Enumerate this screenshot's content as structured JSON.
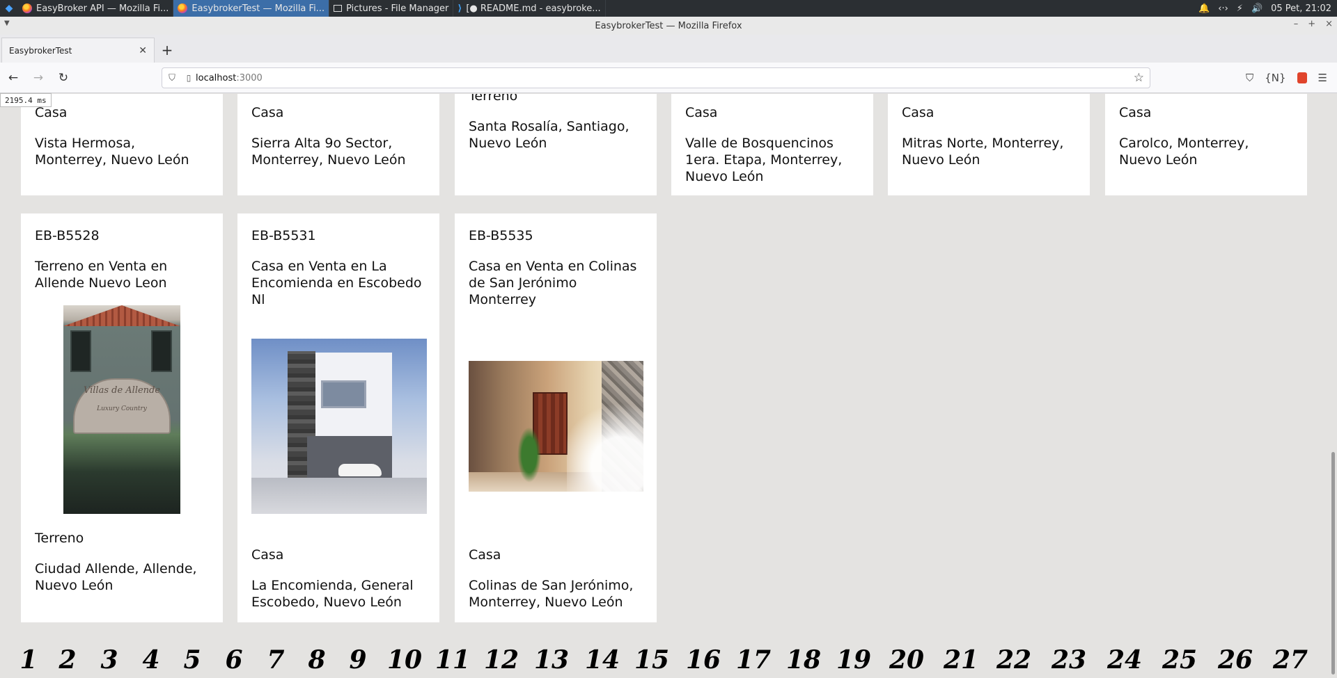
{
  "os_panel": {
    "tasks": [
      {
        "label": "EasyBroker API — Mozilla Fi...",
        "icon": "firefox-icon",
        "active": false
      },
      {
        "label": "EasybrokerTest — Mozilla Fi...",
        "icon": "firefox-icon",
        "active": true
      },
      {
        "label": "Pictures - File Manager",
        "icon": "file-manager-icon",
        "active": false
      },
      {
        "label": "[● README.md - easybroke...",
        "icon": "vscode-icon",
        "active": false
      }
    ],
    "clock": "05 Pet, 21:02"
  },
  "window": {
    "title": "EasybrokerTest — Mozilla Firefox"
  },
  "browser": {
    "tab_title": "EasybrokerTest",
    "url_host": "localhost",
    "url_port": ":3000",
    "timing": "2195.4 ms"
  },
  "listings_top_row": [
    {
      "type": "Casa",
      "location": "Vista Hermosa, Monterrey, Nuevo León"
    },
    {
      "type": "Casa",
      "location": "Sierra Alta 9o Sector, Monterrey, Nuevo León"
    },
    {
      "type": "Terreno",
      "location": "Santa Rosalía, Santiago, Nuevo León"
    },
    {
      "type": "Casa",
      "location": "Valle de Bosquencinos 1era. Etapa, Monterrey, Nuevo León"
    },
    {
      "type": "Casa",
      "location": "Mitras Norte, Monterrey, Nuevo León"
    },
    {
      "type": "Casa",
      "location": "Carolco, Monterrey, Nuevo León"
    }
  ],
  "listings_bottom_row": [
    {
      "id": "EB-B5528",
      "title": "Terreno en Venta en Allende Nuevo Leon",
      "type": "Terreno",
      "location": "Ciudad Allende, Allende, Nuevo León",
      "photo_text": "Villas de Allende",
      "photo_subtext": "Luxury Country"
    },
    {
      "id": "EB-B5531",
      "title": "Casa en Venta en La Encomienda en Escobedo Nl",
      "type": "Casa",
      "location": "La Encomienda, General Escobedo, Nuevo León"
    },
    {
      "id": "EB-B5535",
      "title": "Casa en Venta en Colinas de San Jerónimo Monterrey",
      "type": "Casa",
      "location": "Colinas de San Jerónimo, Monterrey, Nuevo León"
    }
  ],
  "pagination": [
    "1",
    "2",
    "3",
    "4",
    "5",
    "6",
    "7",
    "8",
    "9",
    "10",
    "11",
    "12",
    "13",
    "14",
    "15",
    "16",
    "17",
    "18",
    "19",
    "20",
    "21",
    "22",
    "23",
    "24",
    "25",
    "26",
    "27"
  ]
}
